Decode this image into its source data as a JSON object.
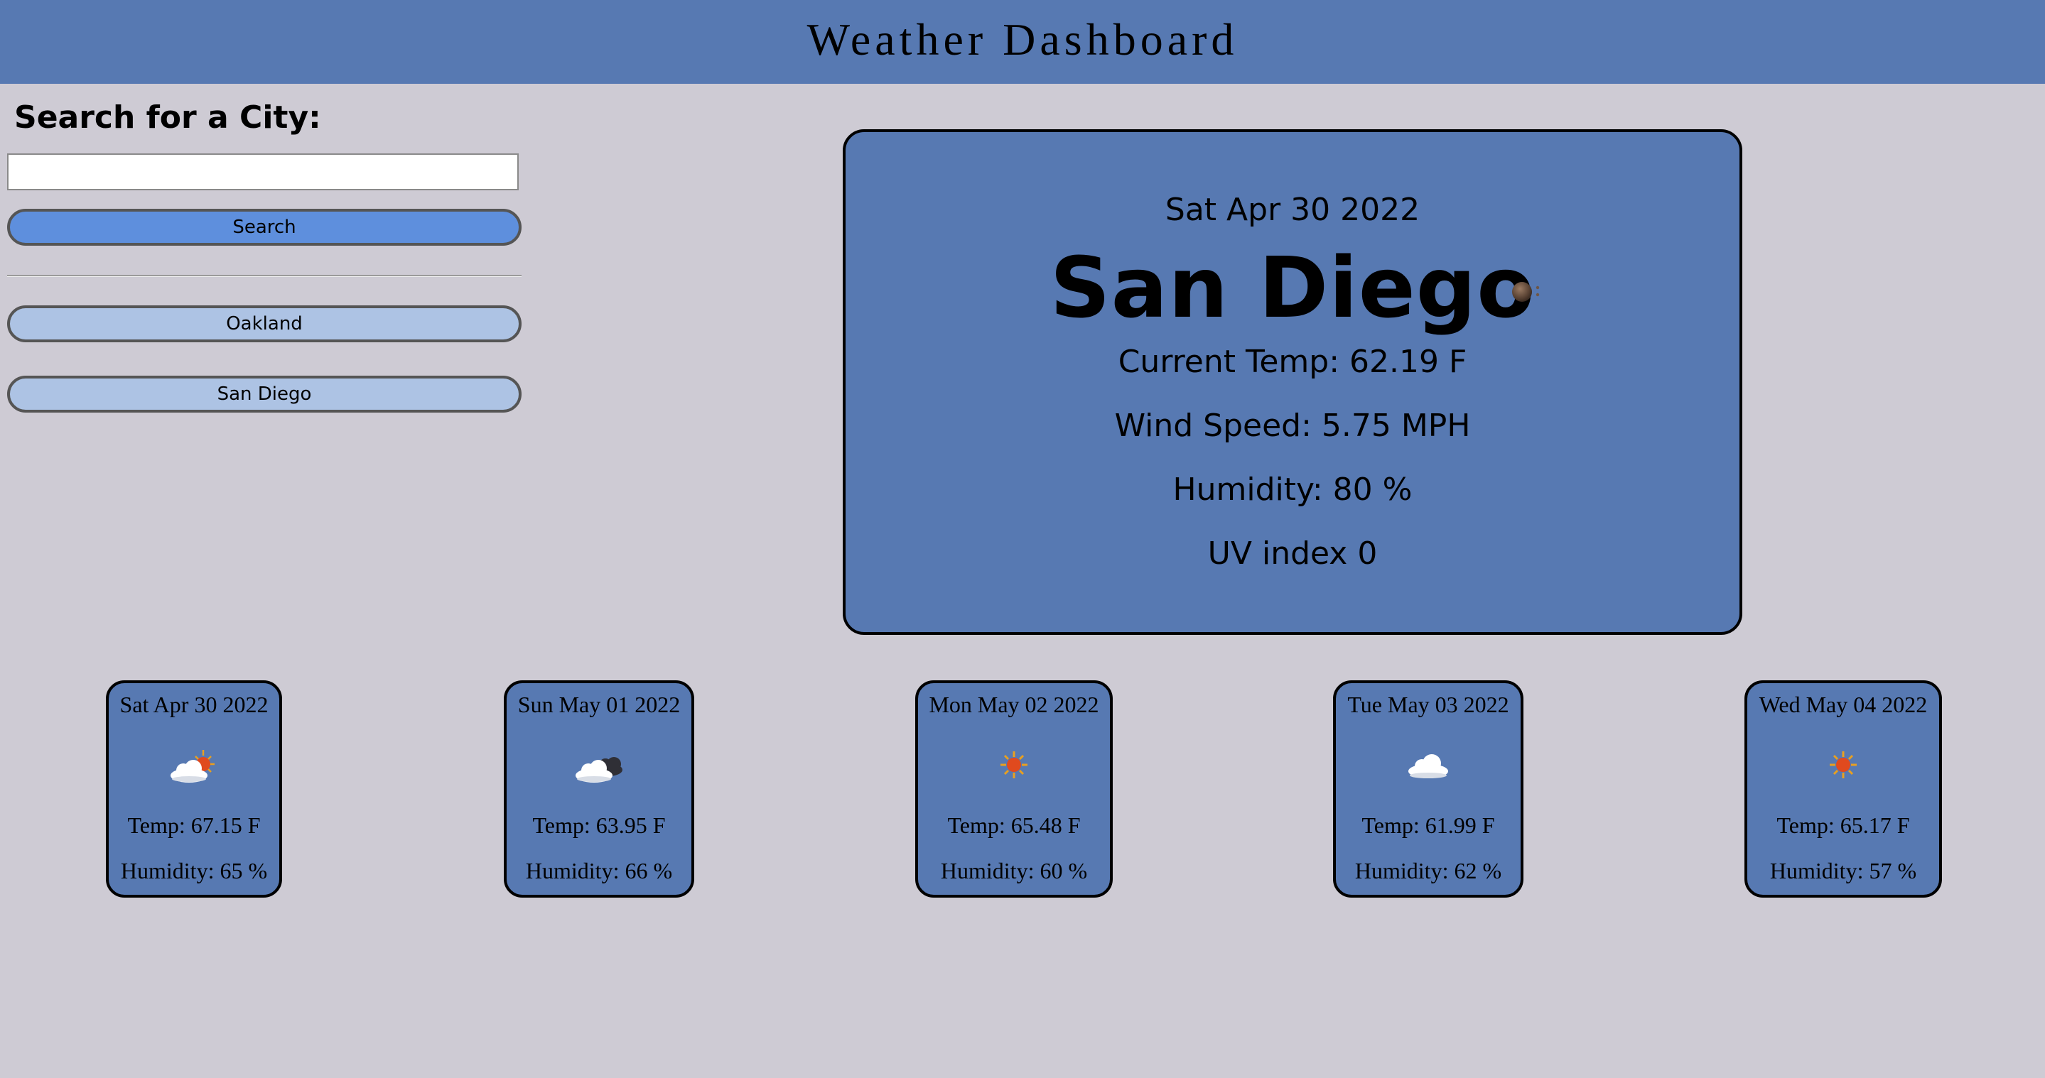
{
  "header": {
    "title": "Weather Dashboard"
  },
  "sidebar": {
    "heading": "Search for a City:",
    "search_value": "",
    "search_button": "Search",
    "history": [
      "Oakland",
      "San Diego"
    ]
  },
  "current": {
    "date": "Sat Apr 30 2022",
    "city": "San Diego",
    "icon": "night-partly-cloudy-icon",
    "temp": "Current Temp: 62.19 F",
    "wind": "Wind Speed: 5.75 MPH",
    "humidity": "Humidity: 80 %",
    "uv": "UV index 0"
  },
  "forecast": [
    {
      "date": "Sat Apr 30 2022",
      "icon": "partly-cloudy-day-icon",
      "temp": "Temp: 67.15 F",
      "humidity": "Humidity: 65 %"
    },
    {
      "date": "Sun May 01 2022",
      "icon": "cloudy-night-icon",
      "temp": "Temp: 63.95 F",
      "humidity": "Humidity: 66 %"
    },
    {
      "date": "Mon May 02 2022",
      "icon": "sun-icon",
      "temp": "Temp: 65.48 F",
      "humidity": "Humidity: 60 %"
    },
    {
      "date": "Tue May 03 2022",
      "icon": "cloud-icon",
      "temp": "Temp: 61.99 F",
      "humidity": "Humidity: 62 %"
    },
    {
      "date": "Wed May 04 2022",
      "icon": "sun-icon",
      "temp": "Temp: 65.17 F",
      "humidity": "Humidity: 57 %"
    }
  ],
  "colors": {
    "page_bg": "#cecbd4",
    "header_bg": "#5779b2",
    "card_bg": "#5779b2",
    "search_button_bg": "#5e8fdd",
    "history_button_bg": "#adc3e4"
  }
}
